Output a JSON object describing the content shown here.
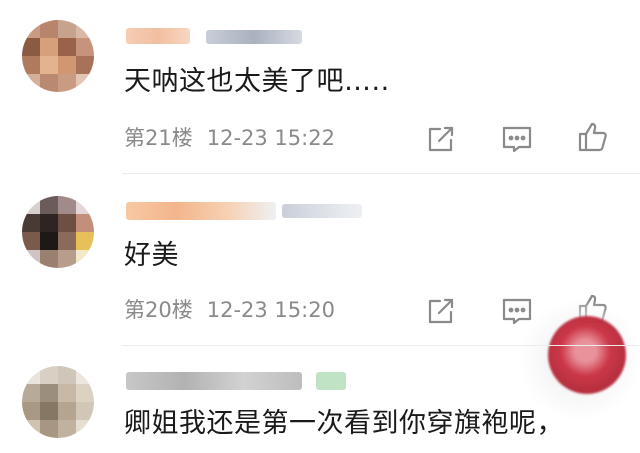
{
  "comments": [
    {
      "text": "天呐这也太美了吧…..",
      "floor": "第21楼",
      "time": "12-23 15:22"
    },
    {
      "text": "好美",
      "floor": "第20楼",
      "time": "12-23 15:20"
    },
    {
      "text": "卿姐我还是第一次看到你穿旗袍呢，"
    }
  ],
  "icons": {
    "reply": "reply-icon",
    "comment": "comment-icon",
    "like": "thumbs-up-icon"
  },
  "colors": {
    "meta_text": "#8a8a8a",
    "body_text": "#1a1a1a",
    "icon_stroke": "#8a8a8a"
  }
}
